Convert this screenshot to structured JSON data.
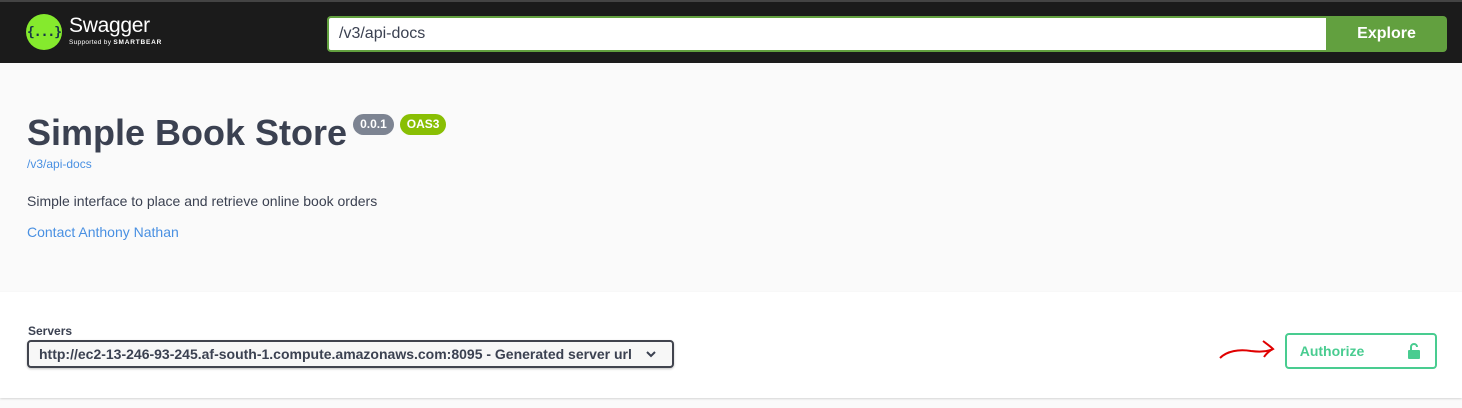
{
  "topbar": {
    "brand_name": "Swagger",
    "brand_supported_by": "Supported by",
    "brand_company": "SMARTBEAR",
    "logo_glyph": "{...}",
    "url_value": "/v3/api-docs",
    "explore_label": "Explore",
    "colors": {
      "background": "#1b1b1b",
      "accent": "#62a03f",
      "logo": "#85ea2d"
    }
  },
  "info": {
    "title": "Simple Book Store",
    "version_badge": "0.0.1",
    "oas_badge": "OAS3",
    "doc_link": "/v3/api-docs",
    "description": "Simple interface to place and retrieve online book orders",
    "contact_link": "Contact Anthony Nathan"
  },
  "servers": {
    "label": "Servers",
    "selected": "http://ec2-13-246-93-245.af-south-1.compute.amazonaws.com:8095 - Generated server url"
  },
  "authorize": {
    "label": "Authorize",
    "icon": "unlocked-lock-icon",
    "color": "#49cc90"
  },
  "annotation": {
    "icon": "red-arrow-annotation",
    "color": "#e00000"
  }
}
